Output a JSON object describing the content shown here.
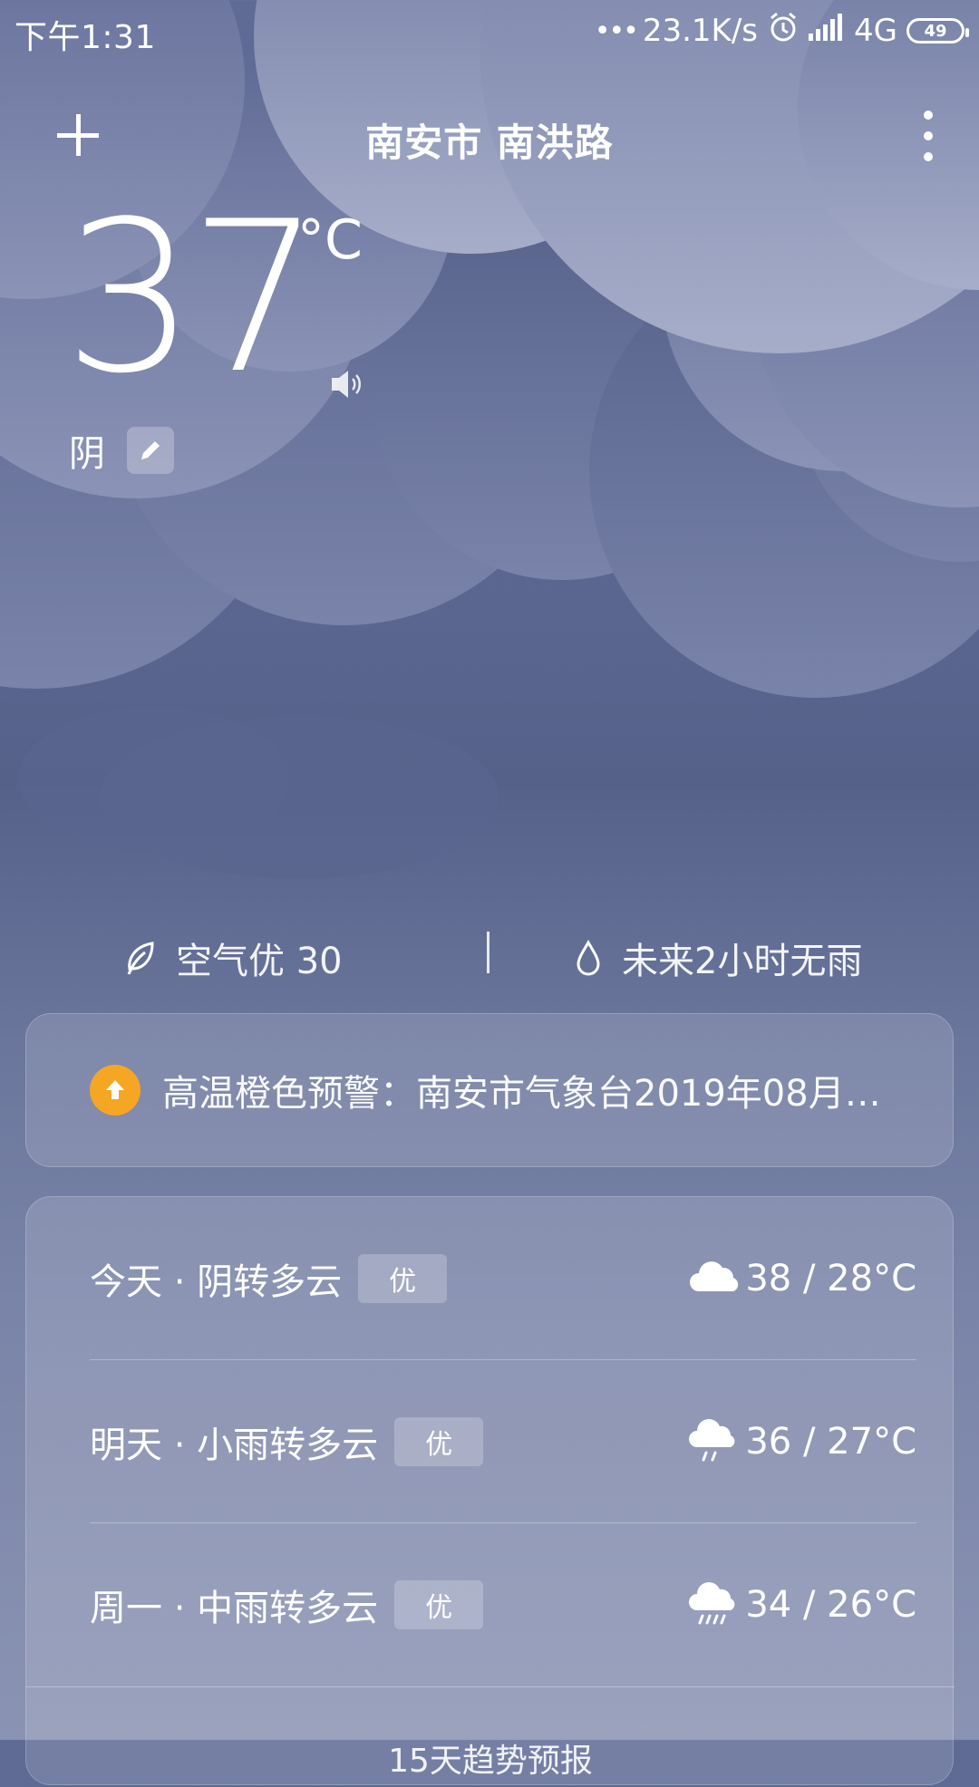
{
  "status_bar": {
    "time": "下午1:31",
    "net_speed": "23.1K/s",
    "network": "4G",
    "battery": "49",
    "icons": [
      "alarm-icon",
      "signal-icon",
      "battery-icon"
    ]
  },
  "header": {
    "location": "南安市  南洪路"
  },
  "current": {
    "temperature": "37",
    "unit": "°C",
    "condition": "阴"
  },
  "info": {
    "air_quality": "空气优 30",
    "rain": "未来2小时无雨"
  },
  "alert": {
    "text": "高温橙色预警：南安市气象台2019年08月…",
    "color": "#f5a623"
  },
  "forecast": [
    {
      "day": "今天 · 阴转多云",
      "aqi": "优",
      "icon": "cloudy-icon",
      "temp": "38 / 28°C"
    },
    {
      "day": "明天 · 小雨转多云",
      "aqi": "优",
      "icon": "light-rain-icon",
      "temp": "36 / 27°C"
    },
    {
      "day": "周一 · 中雨转多云",
      "aqi": "优",
      "icon": "moderate-rain-icon",
      "temp": "34 / 26°C"
    }
  ],
  "forecast_link": "15天趋势预报"
}
